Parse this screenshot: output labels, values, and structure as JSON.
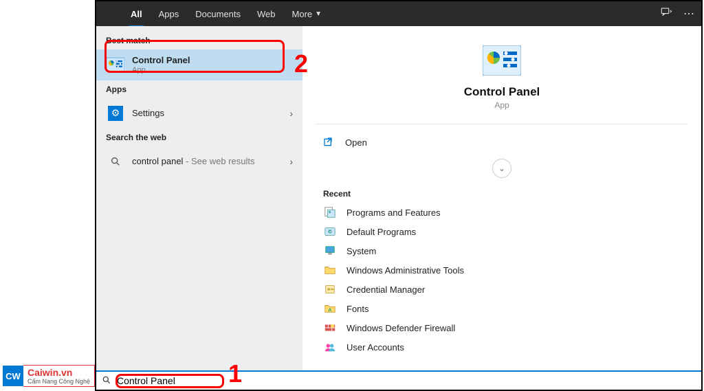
{
  "topbar": {
    "tabs": [
      "All",
      "Apps",
      "Documents",
      "Web",
      "More"
    ]
  },
  "left": {
    "best_match_label": "Best match",
    "best_match": {
      "title": "Control Panel",
      "subtitle": "App"
    },
    "apps_label": "Apps",
    "apps_item": "Settings",
    "web_label": "Search the web",
    "web_item": "control panel",
    "web_suffix": " - See web results"
  },
  "right": {
    "title": "Control Panel",
    "subtitle": "App",
    "open_label": "Open",
    "recent_label": "Recent",
    "recent": [
      "Programs and Features",
      "Default Programs",
      "System",
      "Windows Administrative Tools",
      "Credential Manager",
      "Fonts",
      "Windows Defender Firewall",
      "User Accounts"
    ]
  },
  "search": {
    "value": "Control Panel"
  },
  "annotations": {
    "a1": "1",
    "a2": "2"
  },
  "watermark": {
    "logo": "CW",
    "line1": "Caiwin.vn",
    "line2": "Cẩm Nang Công Nghệ"
  }
}
